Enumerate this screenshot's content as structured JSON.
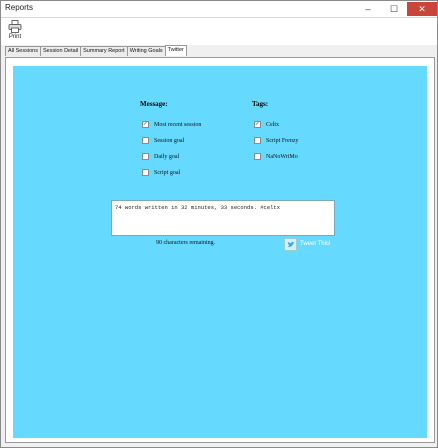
{
  "window": {
    "title": "Reports",
    "controls": {
      "minimize": "–",
      "maximize": "☐",
      "close": "✕"
    }
  },
  "toolbar": {
    "print_label": "Print"
  },
  "tabs": [
    {
      "label": "All Sessions"
    },
    {
      "label": "Session Detail"
    },
    {
      "label": "Summary Report"
    },
    {
      "label": "Writing Goals"
    },
    {
      "label": "Twitter"
    }
  ],
  "twitter": {
    "message_heading": "Message:",
    "tags_heading": "Tags:",
    "message_options": [
      {
        "label": "Most recent session",
        "checked": true
      },
      {
        "label": "Session goal",
        "checked": false
      },
      {
        "label": "Daily goal",
        "checked": false
      },
      {
        "label": "Script goal",
        "checked": false
      }
    ],
    "tag_options": [
      {
        "label": "Celtx",
        "checked": true
      },
      {
        "label": "Script Frenzy",
        "checked": false
      },
      {
        "label": "NaNoWriMo",
        "checked": false
      }
    ],
    "tweet_text": "74 words written in 32 minutes, 33 seconds. #celtx",
    "remaining_text": "90 characters remaining.",
    "tweet_button_label": "Tweet This!",
    "check_mark": "✓"
  },
  "colors": {
    "panel_bg": "#66d9ff",
    "close_red": "#c9453a"
  }
}
